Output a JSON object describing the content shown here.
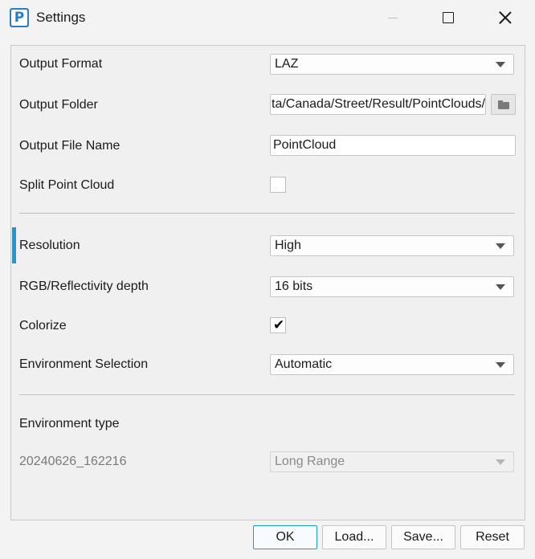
{
  "window": {
    "title": "Settings",
    "icon_letter": "P"
  },
  "fields": {
    "output_format": {
      "label": "Output Format",
      "value": "LAZ"
    },
    "output_folder": {
      "label": "Output Folder",
      "value": "ta/Canada/Street/Result/PointClouds/"
    },
    "output_file_name": {
      "label": "Output File Name",
      "value": "PointCloud"
    },
    "split_point_cloud": {
      "label": "Split Point Cloud",
      "checked": false,
      "mark": ""
    },
    "resolution": {
      "label": "Resolution",
      "value": "High"
    },
    "rgb_depth": {
      "label": "RGB/Reflectivity depth",
      "value": "16 bits"
    },
    "colorize": {
      "label": "Colorize",
      "checked": true,
      "mark": "✔"
    },
    "environment_selection": {
      "label": "Environment Selection",
      "value": "Automatic"
    },
    "environment_type": {
      "label": "Environment type"
    },
    "environment_dataset": {
      "label": "20240626_162216",
      "value": "Long Range",
      "disabled": true
    }
  },
  "buttons": {
    "ok": "OK",
    "load": "Load...",
    "save": "Save...",
    "reset": "Reset"
  },
  "icons": {
    "app": "app-logo-icon",
    "folder": "folder-icon",
    "minimize": "minimize-icon",
    "maximize": "maximize-icon",
    "close": "close-icon"
  },
  "colors": {
    "accent": "#1a9bd7",
    "app_icon": "#2b7fc4"
  }
}
